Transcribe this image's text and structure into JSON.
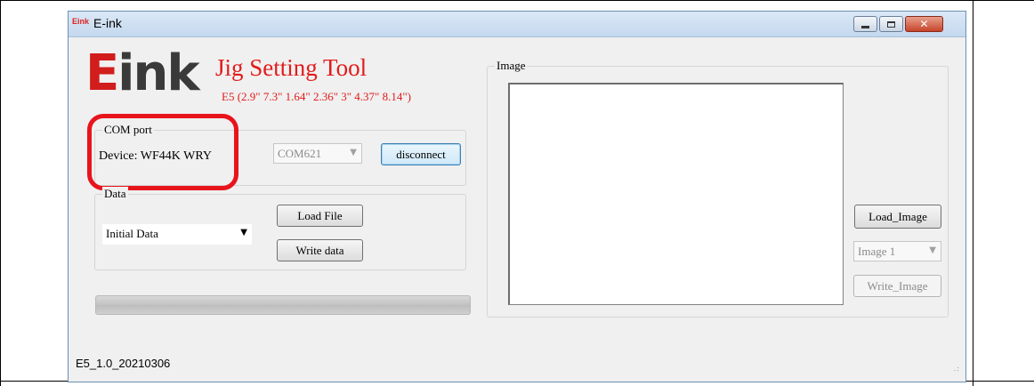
{
  "window": {
    "title": "E-ink",
    "title_logo": "Eink"
  },
  "header": {
    "logo_e": "E",
    "logo_rest": "ink",
    "title": "Jig Setting Tool",
    "subtitle": "E5 (2.9\" 7.3\" 1.64\" 2.36\" 3\" 4.37\" 8.14\")"
  },
  "com_port": {
    "legend": "COM port",
    "device_label": "Device: WF44K WRY",
    "port_value": "COM621",
    "disconnect_label": "disconnect"
  },
  "data": {
    "legend": "Data",
    "selected": "Initial Data",
    "load_file_label": "Load File",
    "write_data_label": "Write data"
  },
  "progress": {
    "value": 0
  },
  "image": {
    "legend": "Image",
    "load_label": "Load_Image",
    "selected": "Image 1",
    "write_label": "Write_Image"
  },
  "status": {
    "version": "E5_1.0_20210306"
  },
  "colors": {
    "brand_red": "#e21b1b",
    "highlight_ring": "#e8141c",
    "window_bg": "#f0f0f0"
  }
}
